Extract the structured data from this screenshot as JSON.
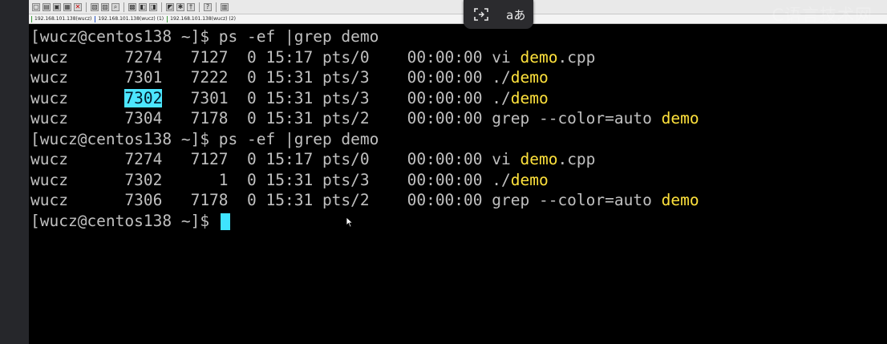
{
  "toolbar": {
    "buttons": [
      "new",
      "open",
      "save",
      "print",
      "disconnect",
      "copy",
      "paste",
      "find",
      "settings",
      "tools",
      "help",
      "script",
      "key",
      "info",
      "layout"
    ]
  },
  "tabs": [
    {
      "label": "192.168.101.138(wucz)"
    },
    {
      "label": "192.168.101.138(wucz) (1)"
    },
    {
      "label": "192.168.101.138(wucz) (2)"
    }
  ],
  "overlay": {
    "screenshot_icon": "crop-icon",
    "translate_label": "aあ"
  },
  "watermark": "C语言技术网",
  "terminal": {
    "lines": [
      {
        "a": "[wucz@centos138 ~]$ ps -ef |grep demo"
      },
      {
        "a": "wucz      7274   7127  0 15:17 pts/0    00:00:00 vi ",
        "h": "demo",
        "b": ".cpp"
      },
      {
        "a": "wucz      7301   7222  0 15:31 pts/3    00:00:00 ./",
        "h": "demo"
      },
      {
        "a": "wucz      ",
        "s": "7302",
        "b2": "   7301  0 15:31 pts/3    00:00:00 ./",
        "h": "demo"
      },
      {
        "a": "wucz      7304   7178  0 15:31 pts/2    00:00:00 grep --color=auto ",
        "h": "demo"
      },
      {
        "a": "[wucz@centos138 ~]$ ps -ef |grep demo"
      },
      {
        "a": "wucz      7274   7127  0 15:17 pts/0    00:00:00 vi ",
        "h": "demo",
        "b": ".cpp"
      },
      {
        "a": "wucz      7302      1  0 15:31 pts/3    00:00:00 ./",
        "h": "demo"
      },
      {
        "a": "wucz      7306   7178  0 15:31 pts/2    00:00:00 grep --color=auto ",
        "h": "demo"
      },
      {
        "a": "[wucz@centos138 ~]$ "
      }
    ]
  }
}
